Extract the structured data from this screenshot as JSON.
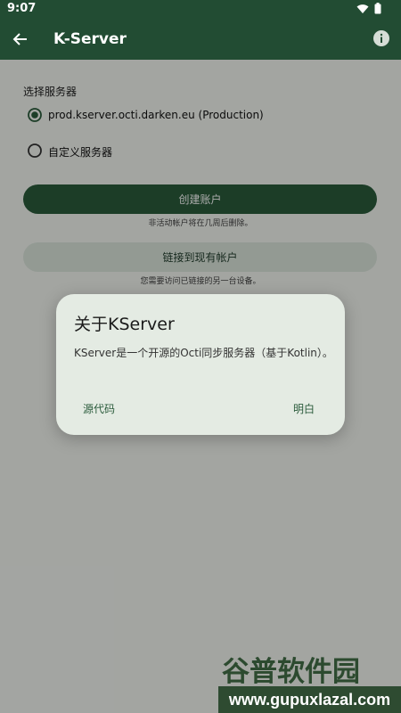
{
  "status_bar": {
    "time": "9:07",
    "wifi_icon": "wifi-icon",
    "battery_icon": "battery-icon"
  },
  "app_bar": {
    "title": "K-Server",
    "back_icon": "back-arrow-icon",
    "info_icon": "info-icon"
  },
  "server_select": {
    "label": "选择服务器",
    "options": [
      {
        "label": "prod.kserver.octi.darken.eu (Production)",
        "selected": true
      },
      {
        "label": "自定义服务器",
        "selected": false
      }
    ]
  },
  "actions": {
    "create_account": {
      "label": "创建账户",
      "hint": "非活动帐户将在几周后删除。"
    },
    "link_existing": {
      "label": "链接到现有帐户",
      "hint": "您需要访问已链接的另一台设备。"
    }
  },
  "dialog": {
    "title": "关于KServer",
    "body": "KServer是一个开源的Octi同步服务器（基于Kotlin）。",
    "source_button": "源代码",
    "ok_button": "明白"
  },
  "watermark": {
    "top": "谷普软件园",
    "bottom": "www.gupuxlazal.com"
  },
  "colors": {
    "primary": "#224c33",
    "button_primary": "#2a5b3b",
    "button_secondary": "#dbe6dc",
    "dialog_bg": "#e4ebe3"
  }
}
